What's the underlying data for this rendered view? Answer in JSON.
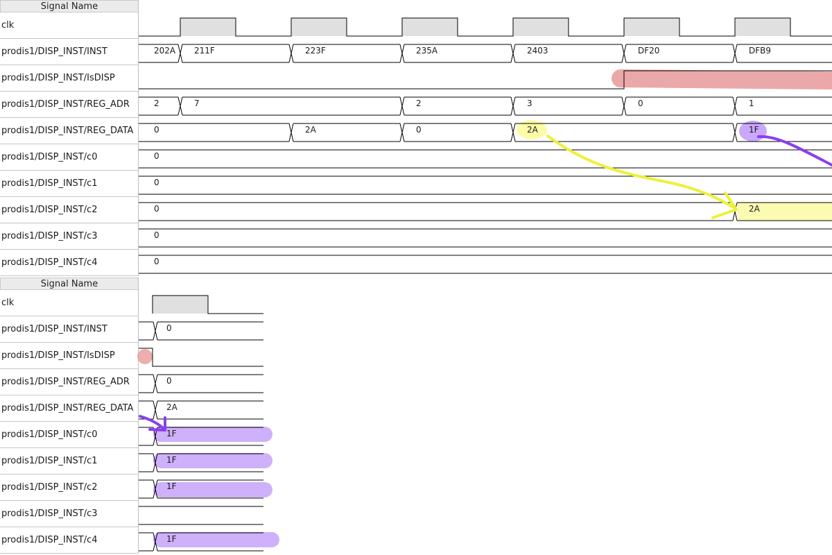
{
  "top_panel": {
    "header": "Signal Name",
    "signals": [
      {
        "name": "clk"
      },
      {
        "name": "prodis1/DISP_INST/INST",
        "segments": [
          {
            "from": 0,
            "value": "202A"
          },
          {
            "from": 1,
            "value": "211F"
          },
          {
            "from": 2,
            "value": "223F"
          },
          {
            "from": 3,
            "value": "235A"
          },
          {
            "from": 4,
            "value": "2403"
          },
          {
            "from": 5,
            "value": "DF20"
          },
          {
            "from": 6,
            "value": "DFB9"
          }
        ]
      },
      {
        "name": "prodis1/DISP_INST/IsDISP"
      },
      {
        "name": "prodis1/DISP_INST/REG_ADR",
        "segments": [
          {
            "from": 0,
            "value": "2"
          },
          {
            "from": 1,
            "value": "7"
          },
          {
            "from": 3,
            "value": "2"
          },
          {
            "from": 4,
            "value": "3"
          },
          {
            "from": 5,
            "value": "0"
          },
          {
            "from": 6,
            "value": "1"
          }
        ]
      },
      {
        "name": "prodis1/DISP_INST/REG_DATA",
        "segments": [
          {
            "from": 0,
            "value": "0"
          },
          {
            "from": 2,
            "value": "2A"
          },
          {
            "from": 3,
            "value": "0"
          },
          {
            "from": 4,
            "value": "2A"
          },
          {
            "from": 6,
            "value": "1F"
          }
        ]
      },
      {
        "name": "prodis1/DISP_INST/c0",
        "segments": [
          {
            "from": 0,
            "value": "0"
          }
        ]
      },
      {
        "name": "prodis1/DISP_INST/c1",
        "segments": [
          {
            "from": 0,
            "value": "0"
          }
        ]
      },
      {
        "name": "prodis1/DISP_INST/c2",
        "segments": [
          {
            "from": 0,
            "value": "0"
          },
          {
            "from": 6,
            "value": "2A"
          }
        ]
      },
      {
        "name": "prodis1/DISP_INST/c3",
        "segments": [
          {
            "from": 0,
            "value": "0"
          }
        ]
      },
      {
        "name": "prodis1/DISP_INST/c4",
        "segments": [
          {
            "from": 0,
            "value": "0"
          }
        ]
      }
    ]
  },
  "bottom_panel": {
    "header": "Signal Name",
    "signals": [
      {
        "name": "clk"
      },
      {
        "name": "prodis1/DISP_INST/INST",
        "value": "0"
      },
      {
        "name": "prodis1/DISP_INST/IsDISP"
      },
      {
        "name": "prodis1/DISP_INST/REG_ADR",
        "value": "0"
      },
      {
        "name": "prodis1/DISP_INST/REG_DATA",
        "value": "2A"
      },
      {
        "name": "prodis1/DISP_INST/c0",
        "value": "1F"
      },
      {
        "name": "prodis1/DISP_INST/c1",
        "value": "1F"
      },
      {
        "name": "prodis1/DISP_INST/c2",
        "value": "1F"
      },
      {
        "name": "prodis1/DISP_INST/c3",
        "value": ""
      },
      {
        "name": "prodis1/DISP_INST/c4",
        "value": "1F"
      }
    ]
  },
  "colors": {
    "trace": "#000000",
    "clock_fill": "#e0e0e0",
    "highlight_red": "#e89a9a",
    "highlight_yellow": "#fbfba8",
    "highlight_purple": "#c9a8fb",
    "arrow_yellow": "#eef03a",
    "arrow_purple": "#8a3ef0"
  }
}
